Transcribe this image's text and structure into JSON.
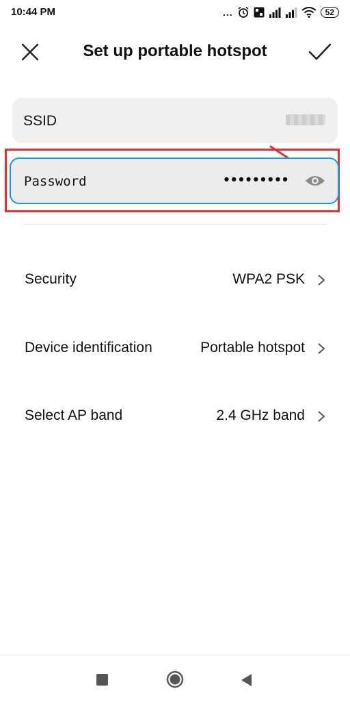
{
  "status_bar": {
    "time": "10:44 PM",
    "dots": "...",
    "battery": "52",
    "icons": [
      "alarm-icon",
      "volte-icon",
      "signal-icon",
      "signal-icon",
      "wifi-icon",
      "battery-icon"
    ]
  },
  "header": {
    "title": "Set up portable hotspot",
    "close_icon": "close-icon",
    "confirm_icon": "check-icon"
  },
  "ssid": {
    "label": "SSID"
  },
  "password": {
    "label": "Password",
    "masked_value": "•••••••••",
    "toggle_icon": "eye-icon"
  },
  "settings": [
    {
      "label": "Security",
      "value": "WPA2 PSK"
    },
    {
      "label": "Device identification",
      "value": "Portable hotspot"
    },
    {
      "label": "Select AP band",
      "value": "2.4 GHz band"
    }
  ],
  "annotation": {
    "highlight_color": "#e03232",
    "arrow_color": "#e03232"
  },
  "colors": {
    "focus_border": "#1a9bd9",
    "field_bg": "#f0f0f0"
  },
  "nav": [
    "recents-icon",
    "home-icon",
    "back-icon"
  ]
}
